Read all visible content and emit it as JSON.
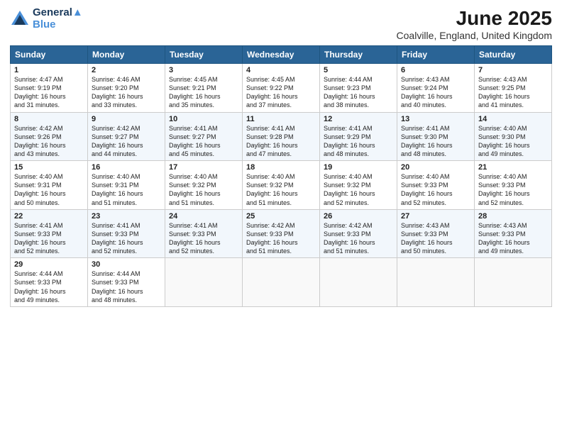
{
  "logo": {
    "line1": "General",
    "line2": "Blue"
  },
  "title": "June 2025",
  "subtitle": "Coalville, England, United Kingdom",
  "headers": [
    "Sunday",
    "Monday",
    "Tuesday",
    "Wednesday",
    "Thursday",
    "Friday",
    "Saturday"
  ],
  "weeks": [
    [
      {
        "day": "1",
        "info": "Sunrise: 4:47 AM\nSunset: 9:19 PM\nDaylight: 16 hours\nand 31 minutes."
      },
      {
        "day": "2",
        "info": "Sunrise: 4:46 AM\nSunset: 9:20 PM\nDaylight: 16 hours\nand 33 minutes."
      },
      {
        "day": "3",
        "info": "Sunrise: 4:45 AM\nSunset: 9:21 PM\nDaylight: 16 hours\nand 35 minutes."
      },
      {
        "day": "4",
        "info": "Sunrise: 4:45 AM\nSunset: 9:22 PM\nDaylight: 16 hours\nand 37 minutes."
      },
      {
        "day": "5",
        "info": "Sunrise: 4:44 AM\nSunset: 9:23 PM\nDaylight: 16 hours\nand 38 minutes."
      },
      {
        "day": "6",
        "info": "Sunrise: 4:43 AM\nSunset: 9:24 PM\nDaylight: 16 hours\nand 40 minutes."
      },
      {
        "day": "7",
        "info": "Sunrise: 4:43 AM\nSunset: 9:25 PM\nDaylight: 16 hours\nand 41 minutes."
      }
    ],
    [
      {
        "day": "8",
        "info": "Sunrise: 4:42 AM\nSunset: 9:26 PM\nDaylight: 16 hours\nand 43 minutes."
      },
      {
        "day": "9",
        "info": "Sunrise: 4:42 AM\nSunset: 9:27 PM\nDaylight: 16 hours\nand 44 minutes."
      },
      {
        "day": "10",
        "info": "Sunrise: 4:41 AM\nSunset: 9:27 PM\nDaylight: 16 hours\nand 45 minutes."
      },
      {
        "day": "11",
        "info": "Sunrise: 4:41 AM\nSunset: 9:28 PM\nDaylight: 16 hours\nand 47 minutes."
      },
      {
        "day": "12",
        "info": "Sunrise: 4:41 AM\nSunset: 9:29 PM\nDaylight: 16 hours\nand 48 minutes."
      },
      {
        "day": "13",
        "info": "Sunrise: 4:41 AM\nSunset: 9:30 PM\nDaylight: 16 hours\nand 48 minutes."
      },
      {
        "day": "14",
        "info": "Sunrise: 4:40 AM\nSunset: 9:30 PM\nDaylight: 16 hours\nand 49 minutes."
      }
    ],
    [
      {
        "day": "15",
        "info": "Sunrise: 4:40 AM\nSunset: 9:31 PM\nDaylight: 16 hours\nand 50 minutes."
      },
      {
        "day": "16",
        "info": "Sunrise: 4:40 AM\nSunset: 9:31 PM\nDaylight: 16 hours\nand 51 minutes."
      },
      {
        "day": "17",
        "info": "Sunrise: 4:40 AM\nSunset: 9:32 PM\nDaylight: 16 hours\nand 51 minutes."
      },
      {
        "day": "18",
        "info": "Sunrise: 4:40 AM\nSunset: 9:32 PM\nDaylight: 16 hours\nand 51 minutes."
      },
      {
        "day": "19",
        "info": "Sunrise: 4:40 AM\nSunset: 9:32 PM\nDaylight: 16 hours\nand 52 minutes."
      },
      {
        "day": "20",
        "info": "Sunrise: 4:40 AM\nSunset: 9:33 PM\nDaylight: 16 hours\nand 52 minutes."
      },
      {
        "day": "21",
        "info": "Sunrise: 4:40 AM\nSunset: 9:33 PM\nDaylight: 16 hours\nand 52 minutes."
      }
    ],
    [
      {
        "day": "22",
        "info": "Sunrise: 4:41 AM\nSunset: 9:33 PM\nDaylight: 16 hours\nand 52 minutes."
      },
      {
        "day": "23",
        "info": "Sunrise: 4:41 AM\nSunset: 9:33 PM\nDaylight: 16 hours\nand 52 minutes."
      },
      {
        "day": "24",
        "info": "Sunrise: 4:41 AM\nSunset: 9:33 PM\nDaylight: 16 hours\nand 52 minutes."
      },
      {
        "day": "25",
        "info": "Sunrise: 4:42 AM\nSunset: 9:33 PM\nDaylight: 16 hours\nand 51 minutes."
      },
      {
        "day": "26",
        "info": "Sunrise: 4:42 AM\nSunset: 9:33 PM\nDaylight: 16 hours\nand 51 minutes."
      },
      {
        "day": "27",
        "info": "Sunrise: 4:43 AM\nSunset: 9:33 PM\nDaylight: 16 hours\nand 50 minutes."
      },
      {
        "day": "28",
        "info": "Sunrise: 4:43 AM\nSunset: 9:33 PM\nDaylight: 16 hours\nand 49 minutes."
      }
    ],
    [
      {
        "day": "29",
        "info": "Sunrise: 4:44 AM\nSunset: 9:33 PM\nDaylight: 16 hours\nand 49 minutes."
      },
      {
        "day": "30",
        "info": "Sunrise: 4:44 AM\nSunset: 9:33 PM\nDaylight: 16 hours\nand 48 minutes."
      },
      {
        "day": "",
        "info": ""
      },
      {
        "day": "",
        "info": ""
      },
      {
        "day": "",
        "info": ""
      },
      {
        "day": "",
        "info": ""
      },
      {
        "day": "",
        "info": ""
      }
    ]
  ]
}
